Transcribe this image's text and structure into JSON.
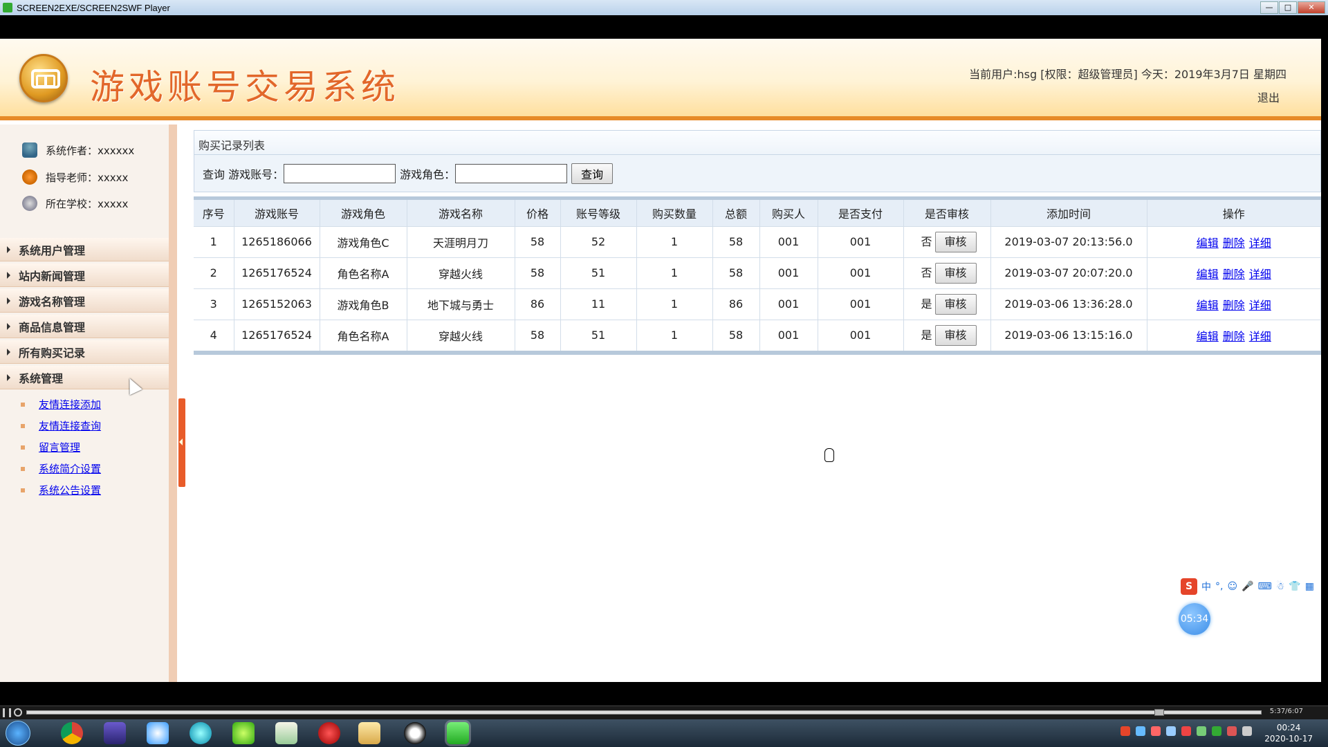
{
  "window": {
    "title": "SCREEN2EXE/SCREEN2SWF Player"
  },
  "header": {
    "site_title": "游戏账号交易系统",
    "user_info": "当前用户:hsg [权限：超级管理员] 今天：2019年3月7日 星期四",
    "logout": "退出"
  },
  "sidebar": {
    "info": [
      {
        "label": "系统作者：xxxxxx",
        "icon": "user-icon"
      },
      {
        "label": "指导老师：xxxxx",
        "icon": "teacher-icon"
      },
      {
        "label": "所在学校：xxxxx",
        "icon": "school-icon"
      }
    ],
    "menu": [
      "系统用户管理",
      "站内新闻管理",
      "游戏名称管理",
      "商品信息管理",
      "所有购买记录",
      "系统管理"
    ],
    "sub_menu": [
      "友情连接添加",
      "友情连接查询",
      "留言管理",
      "系统简介设置",
      "系统公告设置"
    ]
  },
  "main": {
    "panel_title": "购买记录列表",
    "search": {
      "prefix": "查询 游戏账号：",
      "role_label": "游戏角色：",
      "account_value": "",
      "role_value": "",
      "button": "查询"
    },
    "table": {
      "headers": [
        "序号",
        "游戏账号",
        "游戏角色",
        "游戏名称",
        "价格",
        "账号等级",
        "购买数量",
        "总额",
        "购买人",
        "是否支付",
        "是否审核",
        "添加时间",
        "操作"
      ],
      "rows": [
        [
          "1",
          "1265186066",
          "游戏角色C",
          "天涯明月刀",
          "58",
          "52",
          "1",
          "58",
          "001",
          "001",
          "否",
          "2019-03-07 20:13:56.0"
        ],
        [
          "2",
          "1265176524",
          "角色名称A",
          "穿越火线",
          "58",
          "51",
          "1",
          "58",
          "001",
          "001",
          "否",
          "2019-03-07 20:07:20.0"
        ],
        [
          "3",
          "1265152063",
          "游戏角色B",
          "地下城与勇士",
          "86",
          "11",
          "1",
          "86",
          "001",
          "001",
          "是",
          "2019-03-06 13:36:28.0"
        ],
        [
          "4",
          "1265176524",
          "角色名称A",
          "穿越火线",
          "58",
          "51",
          "1",
          "58",
          "001",
          "001",
          "是",
          "2019-03-06 13:15:16.0"
        ]
      ],
      "audit_button": "审核",
      "ops": [
        "编辑",
        "删除",
        "详细"
      ]
    }
  },
  "ime": {
    "logo": "S",
    "mode": "中"
  },
  "timer": "05:34",
  "player": {
    "time": "5:37/6:07"
  },
  "taskbar": {
    "time": "00:24",
    "date": "2020-10-17"
  },
  "colors": {
    "title_orange": "#e2672a",
    "header_border": "#e78a27",
    "link": "#0000ee"
  }
}
